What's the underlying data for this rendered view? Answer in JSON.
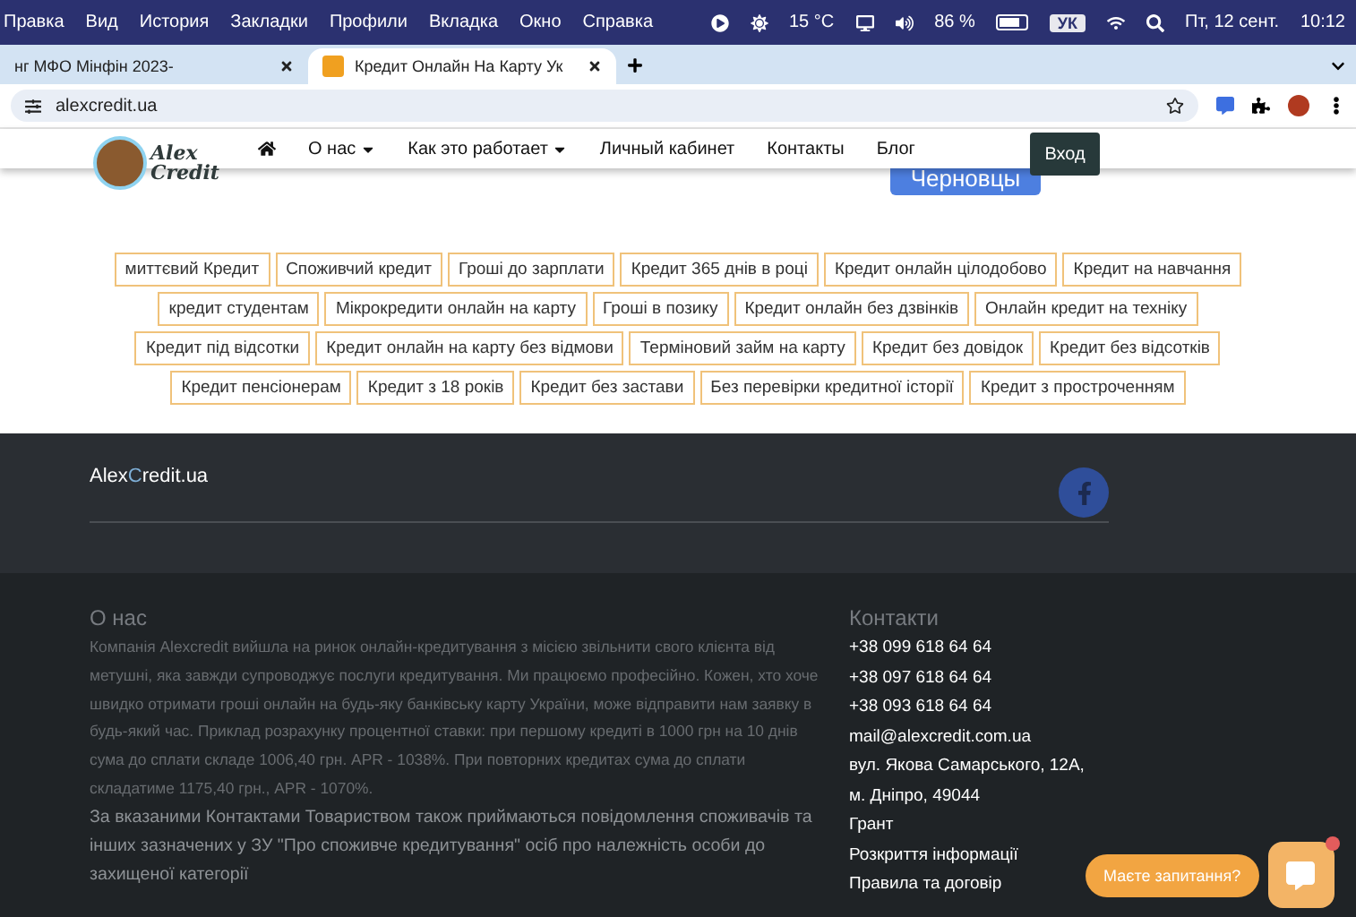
{
  "menu_bar": {
    "items": [
      "Правка",
      "Вид",
      "История",
      "Закладки",
      "Профили",
      "Вкладка",
      "Окно",
      "Справка"
    ],
    "weather": "15 °C",
    "battery": "86 %",
    "input_source": "УК",
    "date": "Пт, 12 сент.",
    "time": "10:12"
  },
  "tabs": [
    {
      "title": "нг МФО Мінфін 2023-",
      "selected": false
    },
    {
      "title": "Кредит Онлайн На Карту Ук",
      "selected": true
    }
  ],
  "address_bar": {
    "url": "alexcredit.ua"
  },
  "site_header": {
    "logo": {
      "line_1": "Alex",
      "line_2": "Credit"
    },
    "nav": [
      {
        "label": "О нас",
        "dropdown": true
      },
      {
        "label": "Как это работает",
        "dropdown": true
      },
      {
        "label": "Личный кабинет",
        "dropdown": false
      },
      {
        "label": "Контакты",
        "dropdown": false
      },
      {
        "label": "Блог",
        "dropdown": false
      }
    ],
    "login_button": "Вход"
  },
  "city_button": "Черновцы",
  "tag_rows": [
    [
      "миттєвий Кредит",
      "Споживчий кредит",
      "Гроші до зарплати",
      "Кредит 365 днів в році",
      "Кредит онлайн цілодобово",
      "Кредит на навчання"
    ],
    [
      "кредит студентам",
      "Мікрокредити онлайн на карту",
      "Гроші в позику",
      "Кредит онлайн без дзвінків",
      "Онлайн кредит на техніку"
    ],
    [
      "Кредит під відсотки",
      "Кредит онлайн на карту без відмови",
      "Терміновий займ на карту",
      "Кредит без довідок",
      "Кредит без відсотків"
    ],
    [
      "Кредит пенсіонерам",
      "Кредит з 18 років",
      "Кредит без застави",
      "Без перевірки кредитної історії",
      "Кредит з простроченням"
    ]
  ],
  "footer": {
    "brand": {
      "before": "Alex",
      "accent": "C",
      "after": "redit.ua"
    },
    "about": {
      "heading": "О нас",
      "paragraphs": [
        {
          "text": "Компанія Alexcredit вийшла на ринок онлайн-кредитування з місією звільнити свого клієнта від метушні, яка завжди супроводжує послуги кредитування. Ми працюємо професійно. Кожен, хто хоче швидко отримати гроші онлайн на будь-яку банківську карту України, може відправити нам заявку в будь-який час. Приклад розрахунку процентної ставки: при першому кредиті в 1000 грн на 10 днів сума до сплати складе 1006,40 грн. APR - 1038%. При повторних кредитах сума до сплати складатиме 1175,40 грн., APR - 1070%.",
          "kind": "small"
        },
        {
          "text": "За вказаними Контактами Товариством також приймаються повідомлення споживачів та інших зазначених у ЗУ \"Про споживче кредитування\" осіб про належність особи до захищеної категорії",
          "kind": "large"
        }
      ]
    },
    "contacts": {
      "heading": "Контакти",
      "lines": [
        "+38 099 618 64 64",
        "+38 097 618 64 64",
        "+38 093 618 64 64",
        "mail@alexcredit.com.ua",
        "вул. Якова Самарського, 12А,",
        "м. Дніпро, 49044",
        "Грант",
        "Розкриття інформації",
        "Правила та договір"
      ]
    }
  },
  "chat": {
    "prompt": "Маєте запитання?",
    "unread": true
  }
}
